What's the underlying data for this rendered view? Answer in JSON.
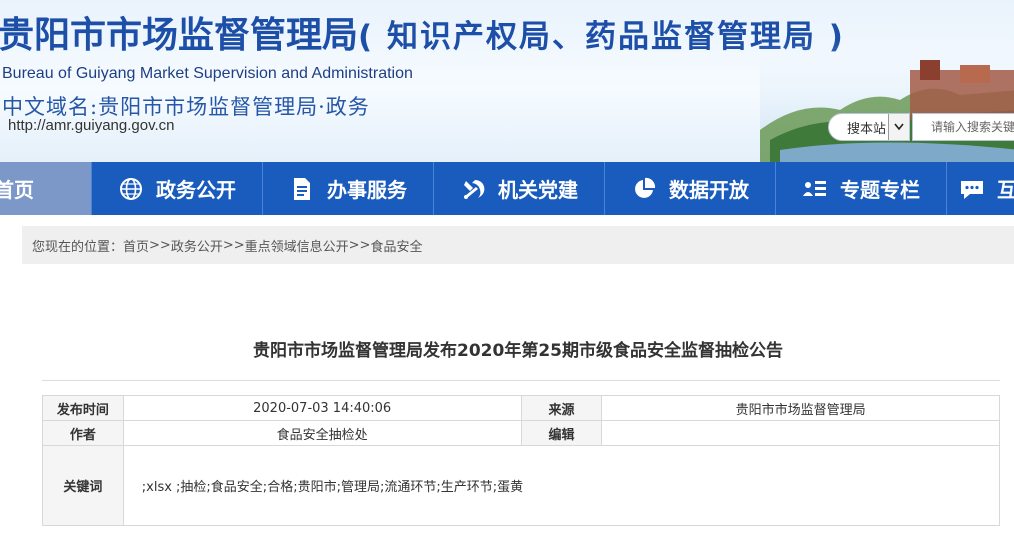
{
  "header": {
    "title_main": "贵阳市市场监督管理局",
    "title_suffix": "( 知识产权局、药品监督管理局 )",
    "title_en": "Bureau of Guiyang Market Supervision and Administration",
    "cn_domain": "中文域名:贵阳市市场监督管理局·政务",
    "url": "http://amr.guiyang.gov.cn"
  },
  "search": {
    "scope_label": "搜本站",
    "placeholder": "请输入搜索关键"
  },
  "nav": {
    "items": [
      {
        "label": "首页",
        "icon": "home-icon"
      },
      {
        "label": "政务公开",
        "icon": "globe-icon"
      },
      {
        "label": "办事服务",
        "icon": "document-icon"
      },
      {
        "label": "机关党建",
        "icon": "party-emblem-icon"
      },
      {
        "label": "数据开放",
        "icon": "pie-chart-icon"
      },
      {
        "label": "专题专栏",
        "icon": "id-card-icon"
      },
      {
        "label": "互",
        "icon": "chat-icon"
      }
    ]
  },
  "breadcrumb": {
    "prefix": "您现在的位置：",
    "items": [
      "首页",
      "政务公开",
      "重点领域信息公开",
      "食品安全"
    ],
    "separator": ">>"
  },
  "article": {
    "title": "贵阳市市场监督管理局发布2020年第25期市级食品安全监督抽检公告",
    "meta": {
      "publish_time_label": "发布时间",
      "publish_time": "2020-07-03 14:40:06",
      "source_label": "来源",
      "source": "贵阳市市场监督管理局",
      "author_label": "作者",
      "author": "食品安全抽检处",
      "editor_label": "编辑",
      "editor": "",
      "keywords_label": "关键词",
      "keywords": ";xlsx  ;抽检;食品安全;合格;贵阳市;管理局;流通环节;生产环节;蛋黄"
    }
  },
  "colors": {
    "nav_bg": "#1a5cbd",
    "nav_home_bg": "#7c98c9",
    "title_blue": "#1d4fa8"
  }
}
